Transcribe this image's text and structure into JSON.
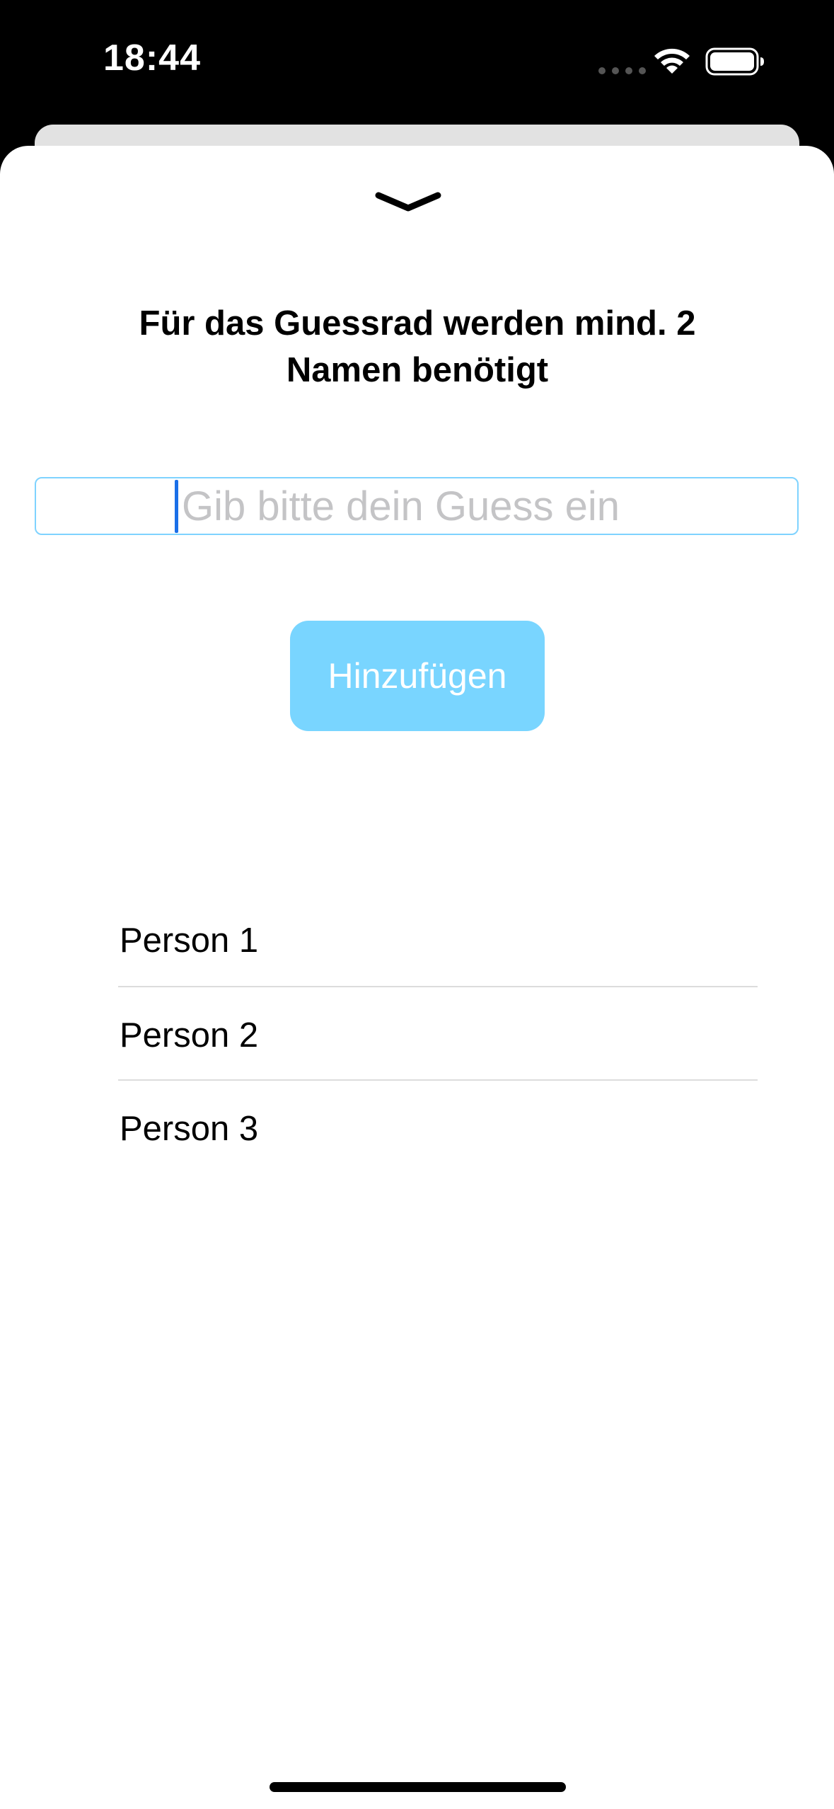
{
  "status_bar": {
    "time": "18:44"
  },
  "sheet": {
    "title": "Für das Guessrad werden mind. 2 Namen benötigt",
    "input": {
      "value": "",
      "placeholder": "Gib bitte dein Guess ein"
    },
    "add_button_label": "Hinzufügen",
    "names": [
      "Person 1",
      "Person 2",
      "Person 3"
    ]
  },
  "colors": {
    "accent": "#79d5ff",
    "input_border": "#7fd3ff",
    "caret": "#1a6fe8",
    "placeholder": "#c4c4c6"
  },
  "icons": [
    "wifi-icon",
    "battery-icon",
    "chevron-down-icon"
  ]
}
